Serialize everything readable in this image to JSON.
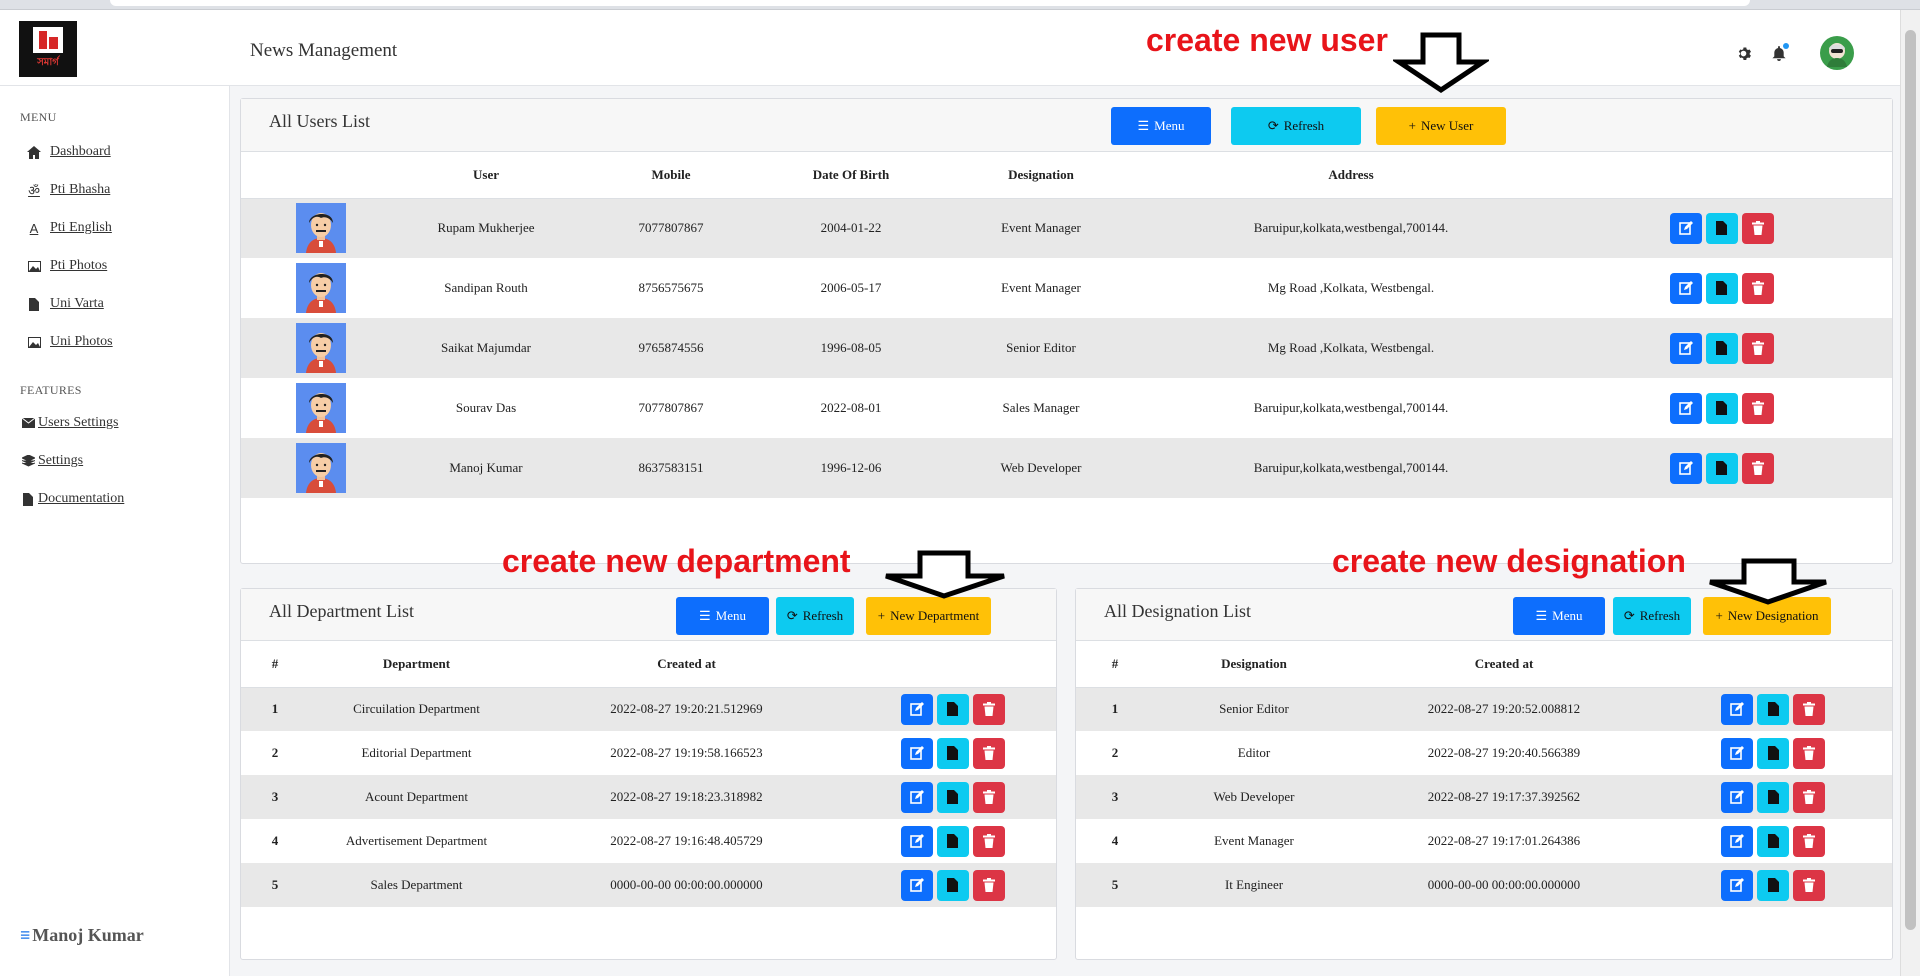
{
  "app": {
    "logo_text": "সমাৰ্গ",
    "title": "News Management"
  },
  "topbar": {
    "icons": [
      "gear-icon",
      "bell-icon",
      "user-avatar"
    ]
  },
  "sidebar": {
    "menu_section": "MENU",
    "menu_items": [
      {
        "label": "Dashboard",
        "icon": "home-icon"
      },
      {
        "label": "Pti Bhasha",
        "icon": "om-icon"
      },
      {
        "label": "Pti English",
        "icon": "letter-a-icon"
      },
      {
        "label": "Pti Photos",
        "icon": "image-icon"
      },
      {
        "label": "Uni Varta",
        "icon": "file-icon"
      },
      {
        "label": "Uni Photos",
        "icon": "image-icon"
      }
    ],
    "features_section": "FEATURES",
    "feature_items": [
      {
        "label": "Users Settings",
        "icon": "envelope-icon"
      },
      {
        "label": "Settings",
        "icon": "layers-icon"
      },
      {
        "label": "Documentation",
        "icon": "file-icon"
      }
    ],
    "user_name": "Manoj Kumar"
  },
  "users_card": {
    "title": "All Users List",
    "menu_label": "Menu",
    "refresh_label": "Refresh",
    "new_label": "New User",
    "columns": [
      "",
      "User",
      "Mobile",
      "Date Of Birth",
      "Designation",
      "Address",
      ""
    ],
    "rows": [
      {
        "name": "Rupam Mukherjee",
        "mobile": "7077807867",
        "dob": "2004-01-22",
        "designation": "Event Manager",
        "address": "Baruipur,kolkata,westbengal,700144."
      },
      {
        "name": "Sandipan Routh",
        "mobile": "8756575675",
        "dob": "2006-05-17",
        "designation": "Event Manager",
        "address": "Mg Road ,Kolkata, Westbengal."
      },
      {
        "name": "Saikat Majumdar",
        "mobile": "9765874556",
        "dob": "1996-08-05",
        "designation": "Senior Editor",
        "address": "Mg Road ,Kolkata, Westbengal."
      },
      {
        "name": "Sourav Das",
        "mobile": "7077807867",
        "dob": "2022-08-01",
        "designation": "Sales Manager",
        "address": "Baruipur,kolkata,westbengal,700144."
      },
      {
        "name": "Manoj Kumar",
        "mobile": "8637583151",
        "dob": "1996-12-06",
        "designation": "Web Developer",
        "address": "Baruipur,kolkata,westbengal,700144."
      }
    ]
  },
  "department_card": {
    "title": "All Department List",
    "menu_label": "Menu",
    "refresh_label": "Refresh",
    "new_label": "New Department",
    "columns": [
      "#",
      "Department",
      "Created at",
      ""
    ],
    "rows": [
      {
        "num": "1",
        "name": "Circuilation Department",
        "created": "2022-08-27 19:20:21.512969"
      },
      {
        "num": "2",
        "name": "Editorial Department",
        "created": "2022-08-27 19:19:58.166523"
      },
      {
        "num": "3",
        "name": "Acount Department",
        "created": "2022-08-27 19:18:23.318982"
      },
      {
        "num": "4",
        "name": "Advertisement Department",
        "created": "2022-08-27 19:16:48.405729"
      },
      {
        "num": "5",
        "name": "Sales Department",
        "created": "0000-00-00 00:00:00.000000"
      }
    ]
  },
  "designation_card": {
    "title": "All Designation List",
    "menu_label": "Menu",
    "refresh_label": "Refresh",
    "new_label": "New Designation",
    "columns": [
      "#",
      "Designation",
      "Created at",
      ""
    ],
    "rows": [
      {
        "num": "1",
        "name": "Senior Editor",
        "created": "2022-08-27 19:20:52.008812"
      },
      {
        "num": "2",
        "name": "Editor",
        "created": "2022-08-27 19:20:40.566389"
      },
      {
        "num": "3",
        "name": "Web Developer",
        "created": "2022-08-27 19:17:37.392562"
      },
      {
        "num": "4",
        "name": "Event Manager",
        "created": "2022-08-27 19:17:01.264386"
      },
      {
        "num": "5",
        "name": "It Engineer",
        "created": "0000-00-00 00:00:00.000000"
      }
    ]
  },
  "annotations": {
    "new_user": "create new user",
    "new_department": "create new department",
    "new_designation": "create new designation"
  },
  "colors": {
    "primary": "#0d6efd",
    "info": "#0dcaf0",
    "warning": "#ffc107",
    "danger": "#dc3545",
    "annotation": "#e8141a"
  }
}
